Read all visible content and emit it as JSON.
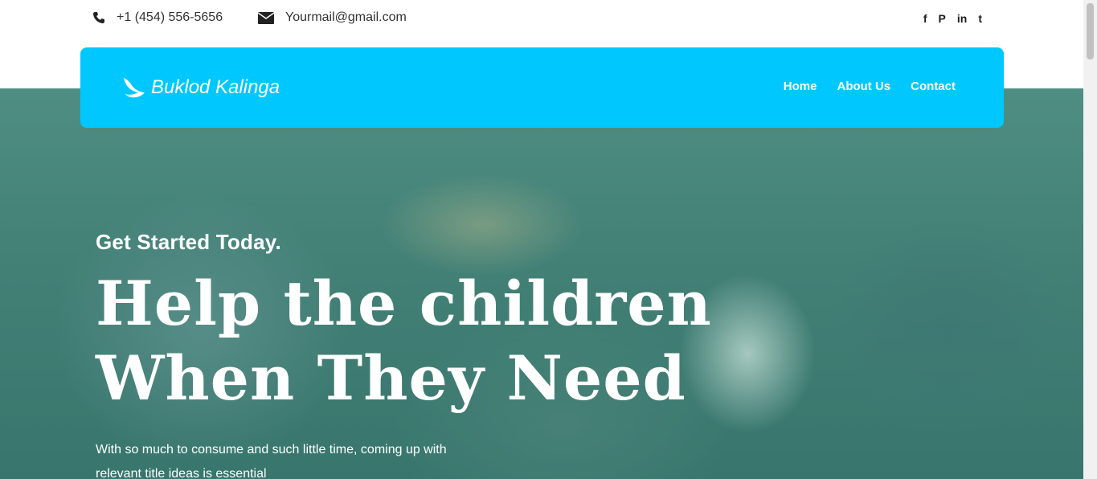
{
  "contact": {
    "phone": "+1 (454) 556-5656",
    "email": "Yourmail@gmail.com"
  },
  "social": [
    {
      "icon": "facebook-icon",
      "glyph": "f"
    },
    {
      "icon": "pinterest-icon",
      "glyph": "P"
    },
    {
      "icon": "linkedin-icon",
      "glyph": "in"
    },
    {
      "icon": "twitter-icon",
      "glyph": "t"
    }
  ],
  "brand": {
    "name": "Buklod Kalinga",
    "accent": "#00c8ff"
  },
  "nav": {
    "items": [
      "Home",
      "About Us",
      "Contact"
    ]
  },
  "hero": {
    "eyebrow": "Get Started Today.",
    "headline_line1": "Help the children",
    "headline_line2": "When They Need",
    "subtitle": "With so much to consume and such little time, coming up with relevant title ideas is essential"
  }
}
